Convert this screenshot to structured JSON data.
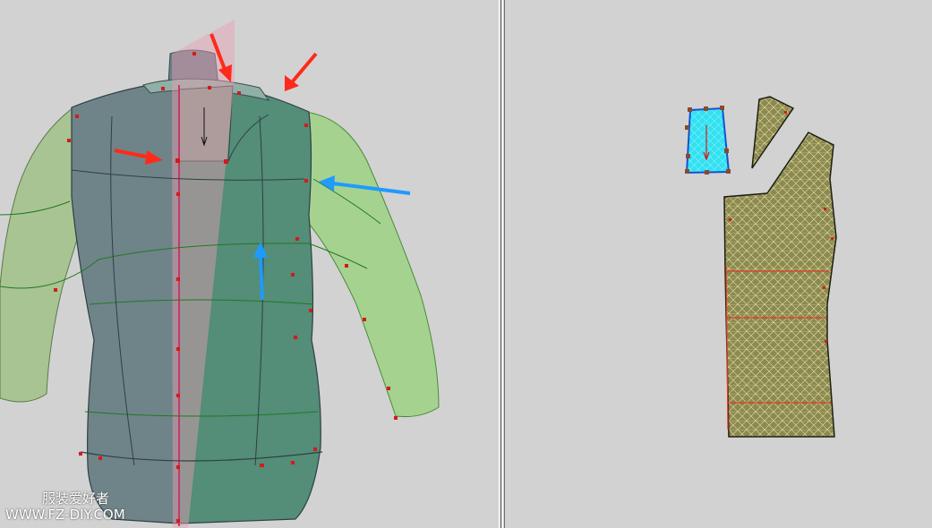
{
  "watermark": {
    "line1": "服装爱好者",
    "line2": "WWW.FZ-DIY.COM"
  },
  "colors": {
    "background": "#d2d2d2",
    "body_green": "#4f8a77",
    "body_gray": "#6c8488",
    "sleeve_green": "#a8cc8a",
    "pattern_olive": "#8c8a4e",
    "selected_piece": "#33e0f0",
    "marker_red": "#d41a1a",
    "arrow_red": "#ff2a1a",
    "arrow_blue": "#1f9aff"
  },
  "icons": {
    "red_arrows": [
      "arrow-down-right-icon",
      "arrow-up-right-icon",
      "arrow-right-icon"
    ],
    "blue_arrows": [
      "arrow-left-icon",
      "arrow-up-icon"
    ]
  }
}
